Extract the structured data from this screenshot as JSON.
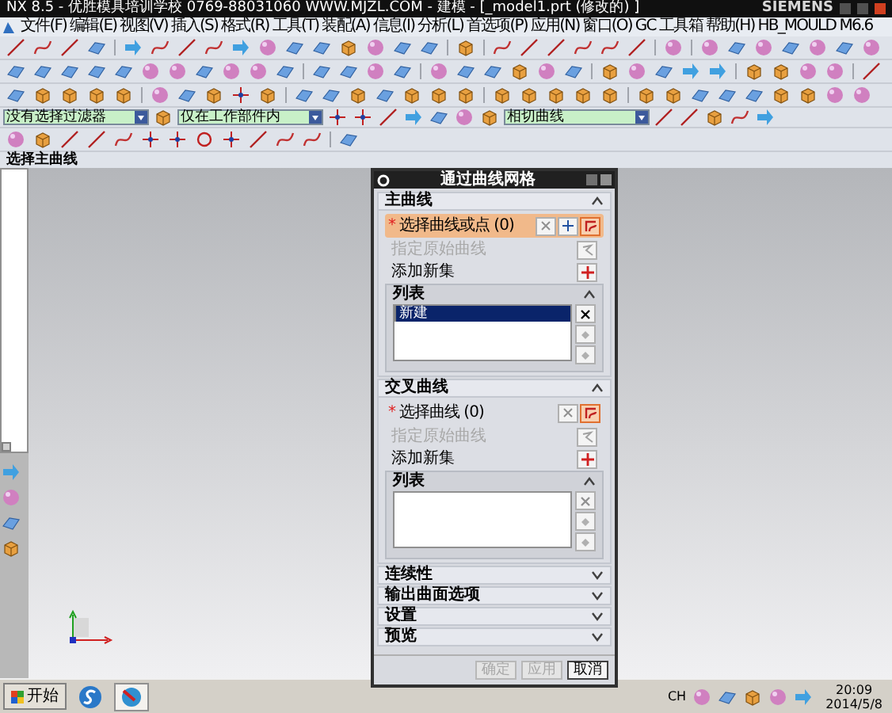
{
  "window": {
    "title": "NX 8.5 - 优胜模具培训学校 0769-88031060 WWW.MJZL.COM - 建模 - [_model1.prt (修改的) ]",
    "brand": "SIEMENS"
  },
  "menu": [
    "文件(F)",
    "编辑(E)",
    "视图(V)",
    "插入(S)",
    "格式(R)",
    "工具(T)",
    "装配(A)",
    "信息(I)",
    "分析(L)",
    "首选项(P)",
    "应用(N)",
    "窗口(O)",
    "GC 工具箱",
    "帮助(H)",
    "HB_MOULD M6.6"
  ],
  "filters": [
    {
      "value": "没有选择过滤器"
    },
    {
      "value": "仅在工作部件内"
    },
    {
      "value": "相切曲线"
    }
  ],
  "resource_bar": {
    "title": "选择主曲线"
  },
  "dialog": {
    "title": "通过曲线网格",
    "sections": [
      {
        "title": "主曲线",
        "expanded": true,
        "select": {
          "required_mark": "*",
          "label": "选择曲线或点 (0)",
          "active": true
        },
        "origin": {
          "label": "指定原始曲线",
          "disabled": true
        },
        "add_set": "添加新集",
        "list": {
          "title": "列表",
          "rows": [
            {
              "label": "新建",
              "selected": true
            }
          ]
        }
      },
      {
        "title": "交叉曲线",
        "expanded": true,
        "select": {
          "required_mark": "*",
          "label": "选择曲线 (0)",
          "active": false
        },
        "origin": {
          "label": "指定原始曲线",
          "disabled": true
        },
        "add_set": "添加新集",
        "list": {
          "title": "列表"
        }
      },
      {
        "title": "连续性",
        "expanded": false
      },
      {
        "title": "输出曲面选项",
        "expanded": false
      },
      {
        "title": "设置",
        "expanded": false
      },
      {
        "title": "预览",
        "expanded": false
      }
    ],
    "buttons": [
      {
        "label": "确定",
        "disabled": true
      },
      {
        "label": "应用",
        "disabled": true
      },
      {
        "label": "取消",
        "disabled": false
      }
    ]
  },
  "taskbar": {
    "start": "开始",
    "tray_text": "CH",
    "time": "20:09",
    "date": "2014/5/8"
  }
}
